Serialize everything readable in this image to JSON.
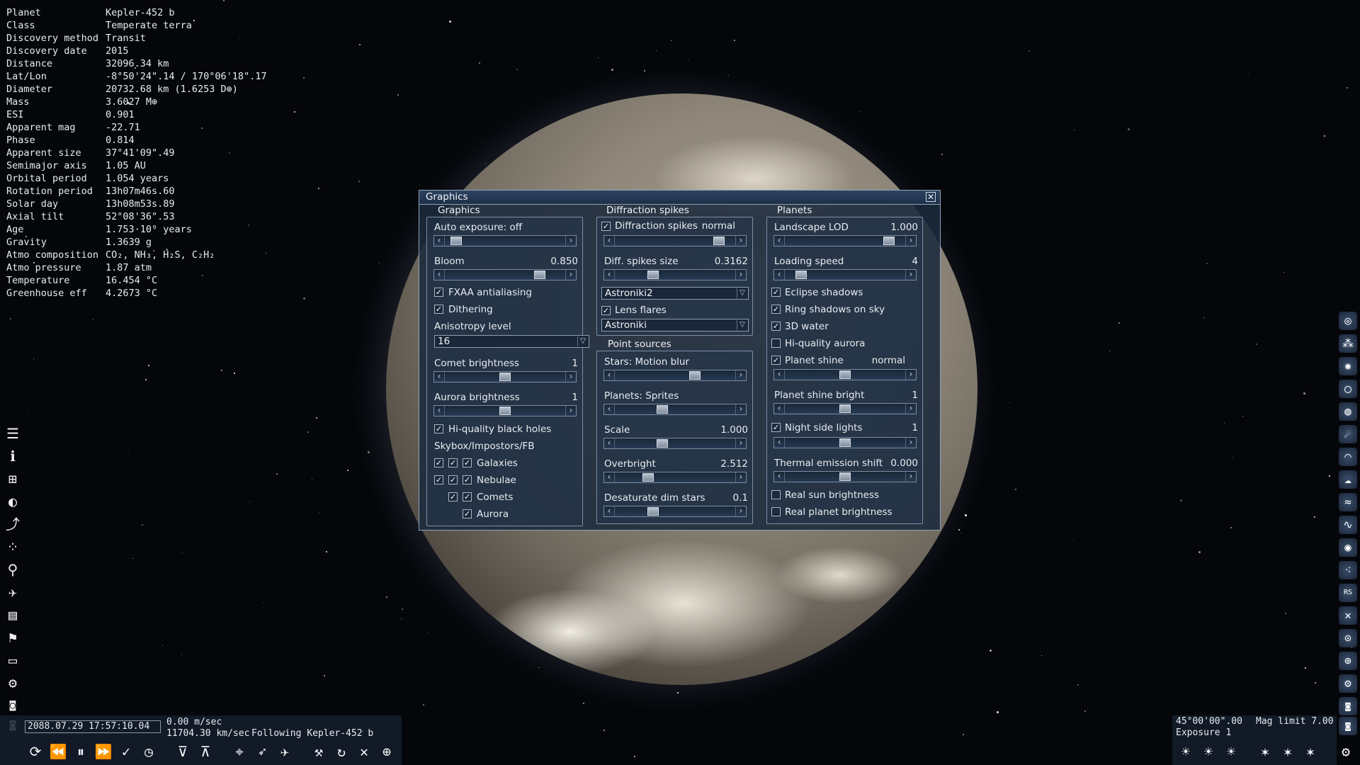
{
  "info": [
    {
      "k": "Planet",
      "v": "Kepler-452 b"
    },
    {
      "k": "Class",
      "v": "Temperate terra"
    },
    {
      "k": "Discovery method",
      "v": "Transit"
    },
    {
      "k": "Discovery date",
      "v": "2015"
    },
    {
      "k": "Distance",
      "v": "32096.34 km"
    },
    {
      "k": "Lat/Lon",
      "v": "-8°50'24\".14 / 170°06'18\".17"
    },
    {
      "k": "Diameter",
      "v": "20732.68 km (1.6253 D⊕)"
    },
    {
      "k": "Mass",
      "v": "3.6027 M⊕"
    },
    {
      "k": "ESI",
      "v": "0.901"
    },
    {
      "k": "Apparent mag",
      "v": "-22.71"
    },
    {
      "k": "Phase",
      "v": "0.814"
    },
    {
      "k": "Apparent size",
      "v": "37°41'09\".49"
    },
    {
      "k": "Semimajor axis",
      "v": "1.05 AU"
    },
    {
      "k": "Orbital period",
      "v": "1.054 years"
    },
    {
      "k": "Rotation period",
      "v": "13h07m46s.60"
    },
    {
      "k": "Solar day",
      "v": "13h08m53s.89"
    },
    {
      "k": "Axial tilt",
      "v": "52°08'36\".53"
    },
    {
      "k": "Age",
      "v": "1.753·10⁹ years"
    },
    {
      "k": "Gravity",
      "v": "1.3639 g"
    },
    {
      "k": "Atmo composition",
      "v": "CO₂, NH₃, H₂S, C₂H₂"
    },
    {
      "k": "Atmo pressure",
      "v": "1.87 atm"
    },
    {
      "k": "Temperature",
      "v": "16.454 °C"
    },
    {
      "k": "Greenhouse eff",
      "v": "4.2673 °C"
    }
  ],
  "dialog": {
    "title": "Graphics",
    "close": "✕",
    "graphics": {
      "label": "Graphics",
      "auto_exposure": {
        "label": "Auto exposure: off",
        "level": 0.05
      },
      "bloom": {
        "label": "Bloom",
        "value": "0.850",
        "level": 0.82
      },
      "fxaa": {
        "label": "FXAA antialiasing",
        "checked": true
      },
      "dithering": {
        "label": "Dithering",
        "checked": true
      },
      "anisotropy": {
        "label": "Anisotropy level",
        "value": "16"
      },
      "comet": {
        "label": "Comet brightness",
        "value": "1",
        "level": 0.5
      },
      "aurora": {
        "label": "Aurora brightness",
        "value": "1",
        "level": 0.5
      },
      "hq_black_holes": {
        "label": "Hi-quality black holes",
        "checked": true
      },
      "skybox_label": "Skybox/Impostors/FB",
      "galaxies": "Galaxies",
      "nebulae": "Nebulae",
      "comets": "Comets",
      "aurora_item": "Aurora"
    },
    "diffraction": {
      "label": "Diffraction spikes",
      "spikes": {
        "label": "Diffraction spikes",
        "mode": "normal",
        "checked": true,
        "level": 0.9
      },
      "size": {
        "label": "Diff. spikes size",
        "value": "0.3162",
        "level": 0.3
      },
      "preset1": "Astroniki2",
      "lens_flares": {
        "label": "Lens flares",
        "checked": true
      },
      "preset2": "Astroniki"
    },
    "points": {
      "label": "Point sources",
      "stars": {
        "label": "Stars: Motion blur",
        "level": 0.68
      },
      "planets": {
        "label": "Planets: Sprites",
        "level": 0.38
      },
      "scale": {
        "label": "Scale",
        "value": "1.000",
        "level": 0.38
      },
      "overbright": {
        "label": "Overbright",
        "value": "2.512",
        "level": 0.25
      },
      "desat": {
        "label": "Desaturate dim stars",
        "value": "0.1",
        "level": 0.3
      }
    },
    "planets": {
      "label": "Planets",
      "lod": {
        "label": "Landscape LOD",
        "value": "1.000",
        "level": 0.9
      },
      "loading": {
        "label": "Loading speed",
        "value": "4",
        "level": 0.1
      },
      "eclipse": {
        "label": "Eclipse shadows",
        "checked": true
      },
      "ring": {
        "label": "Ring shadows on sky",
        "checked": true
      },
      "water": {
        "label": "3D water",
        "checked": true
      },
      "hq_aurora": {
        "label": "Hi-quality aurora",
        "checked": false
      },
      "shine": {
        "label": "Planet shine",
        "mode": "normal",
        "checked": true,
        "level": 0.5
      },
      "shine_bright": {
        "label": "Planet shine bright",
        "value": "1",
        "level": 0.5
      },
      "night": {
        "label": "Night side lights",
        "value": "1",
        "checked": true,
        "level": 0.5
      },
      "thermal": {
        "label": "Thermal emission shift",
        "value": "0.000",
        "level": 0.5
      },
      "real_sun": {
        "label": "Real sun brightness",
        "checked": false
      },
      "real_planet": {
        "label": "Real planet brightness",
        "checked": false
      }
    }
  },
  "bottom": {
    "datetime": "2088.07.29 17:57:10.04",
    "speed": "0.00 m/sec",
    "speed2": "11704.30 km/sec",
    "following": "Following Kepler-452 b",
    "fov": "45°00'00\".00",
    "mag": "Mag limit  7.00",
    "exposure": "Exposure 1"
  }
}
